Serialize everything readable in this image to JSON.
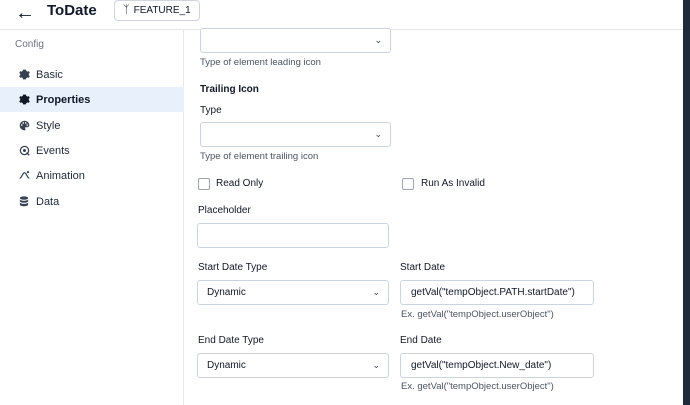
{
  "header": {
    "title": "ToDate",
    "branch": "FEATURE_1"
  },
  "sidebar": {
    "section_label": "Config",
    "items": [
      {
        "label": "Basic",
        "icon": "gear-icon"
      },
      {
        "label": "Properties",
        "icon": "gear-icon"
      },
      {
        "label": "Style",
        "icon": "palette-icon"
      },
      {
        "label": "Events",
        "icon": "events-icon"
      },
      {
        "label": "Animation",
        "icon": "animation-icon"
      },
      {
        "label": "Data",
        "icon": "database-icon"
      }
    ],
    "active_index": 1
  },
  "form": {
    "leading_icon_hint": "Type of element leading icon",
    "trailing_icon_heading": "Trailing Icon",
    "trailing_type_label": "Type",
    "trailing_type_value": "",
    "trailing_icon_hint": "Type of element trailing icon",
    "read_only_label": "Read Only",
    "run_as_invalid_label": "Run As Invalid",
    "placeholder_label": "Placeholder",
    "placeholder_value": "",
    "start_date_type_label": "Start Date Type",
    "start_date_type_value": "Dynamic",
    "start_date_label": "Start Date",
    "start_date_value": "getVal(\"tempObject.PATH.startDate\")",
    "start_date_hint": "Ex. getVal(\"tempObject.userObject\")",
    "end_date_type_label": "End Date Type",
    "end_date_type_value": "Dynamic",
    "end_date_label": "End Date",
    "end_date_value": "getVal(\"tempObject.New_date\")",
    "end_date_hint": "Ex. getVal(\"tempObject.userObject\")"
  }
}
